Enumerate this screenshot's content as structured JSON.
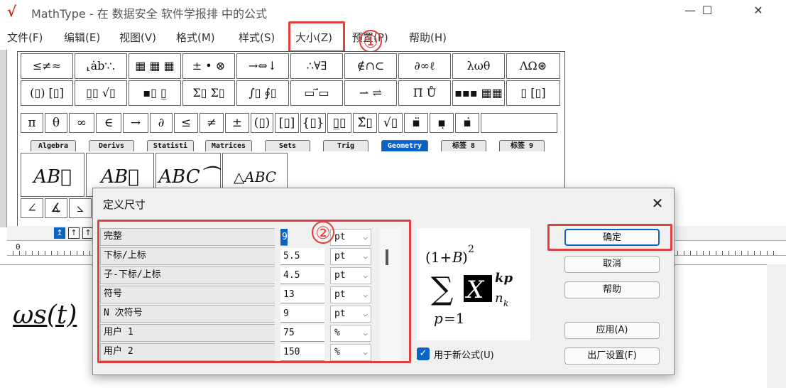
{
  "window": {
    "logo_glyph": "√",
    "title": "MathType - 在 数据安全 软件学报排 中的公式",
    "minimize": "—",
    "maximize": "☐",
    "close": "✕"
  },
  "menu": {
    "items": [
      "文件(F)",
      "编辑(E)",
      "视图(V)",
      "格式(M)",
      "样式(S)",
      "大小(Z)",
      "预置(P)",
      "帮助(H)"
    ]
  },
  "palette": {
    "row1": [
      "≤≠≈",
      "⸤ȧb∵.",
      "▦ ▦ ▦",
      "± • ⊗",
      "→⇔↓",
      "∴∀∃",
      "∉∩⊂",
      "∂∞ℓ",
      "λωθ",
      "ΛΩ⊛"
    ],
    "row2": [
      "(▯) [▯]",
      "▯̲▯ √▯",
      "▪▯ ▯̲",
      "Σ▯ Σ▯",
      "∫▯ ∮▯",
      "▭ ⃗▭",
      "⇀ ⇌",
      "Π̄ Ů",
      "▪▪▪ ▦▦",
      "▯ [▯]"
    ],
    "row3": [
      "π",
      "θ",
      "∞",
      "∈",
      "→",
      "∂",
      "≤",
      "≠",
      "±",
      "(▯)",
      "[▯]",
      "{▯}",
      "▯̲▯",
      "Σ̂▯",
      "√▯",
      "▪̈",
      "▪̣",
      "▪̇"
    ],
    "tabs": [
      "Algebra",
      "Derivs",
      "Statisti",
      "Matrices",
      "Sets",
      "Trig",
      "Geometry",
      "标签 8",
      "标签 9"
    ],
    "big_buttons": [
      "AB⃡",
      "AB⃖",
      "ABC⏜",
      "△ABC"
    ],
    "row5": [
      "∠",
      "∡",
      "⦣"
    ]
  },
  "ruler": {
    "origin_label": "0"
  },
  "editor": {
    "formula_fragment": "ωs(t)"
  },
  "annotations": {
    "one": "①",
    "two": "②"
  },
  "dialog": {
    "title": "定义尺寸",
    "close": "✕",
    "rows": [
      {
        "label": "完整",
        "value": "9",
        "unit": "pt"
      },
      {
        "label": "下标/上标",
        "value": "5.5",
        "unit": "pt"
      },
      {
        "label": "子-下标/上标",
        "value": "4.5",
        "unit": "pt"
      },
      {
        "label": "符号",
        "value": "13",
        "unit": "pt"
      },
      {
        "label": "N 次符号",
        "value": "9",
        "unit": "pt"
      },
      {
        "label": "用户 1",
        "value": "75",
        "unit": "%"
      },
      {
        "label": "用户 2",
        "value": "150",
        "unit": "%"
      }
    ],
    "buttons": {
      "ok": "确定",
      "cancel": "取消",
      "help": "帮助",
      "apply": "应用(A)",
      "factory": "出厂设置(F)"
    },
    "checkbox_label": "用于新公式(U)",
    "checkbox_checked": true
  },
  "colors": {
    "highlight_red": "#e04040",
    "accent_blue": "#0b63c5"
  }
}
